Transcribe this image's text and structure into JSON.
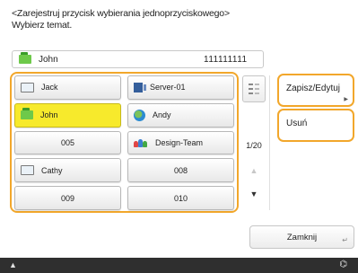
{
  "header": {
    "line1": "<Zarejestruj przycisk wybierania jednoprzyciskowego>",
    "line2": "Wybierz temat."
  },
  "selected_entry": {
    "name": "John",
    "number": "111111111",
    "icon": "address-book-green-icon"
  },
  "grid": [
    {
      "label": "Jack",
      "icon": "address-card-icon"
    },
    {
      "label": "Server-01",
      "icon": "server-icon"
    },
    {
      "label": "John",
      "icon": "address-book-green-icon",
      "selected": true
    },
    {
      "label": "Andy",
      "icon": "globe-icon"
    },
    {
      "label": "005",
      "icon": ""
    },
    {
      "label": "Design-Team",
      "icon": "group-icon"
    },
    {
      "label": "Cathy",
      "icon": "address-card-icon"
    },
    {
      "label": "008",
      "icon": ""
    },
    {
      "label": "009",
      "icon": ""
    },
    {
      "label": "010",
      "icon": ""
    }
  ],
  "pager": {
    "counter": "1/20",
    "sort_icon": "sort-icon",
    "up_icon": "arrow-up-icon",
    "down_icon": "arrow-down-icon"
  },
  "actions": {
    "save_edit": "Zapisz/Edytuj",
    "delete": "Usuń"
  },
  "close": {
    "label": "Zamknij"
  },
  "status": {
    "left_glyph": "▲",
    "right_glyph": "⌬"
  },
  "colors": {
    "highlight": "#f2a72b",
    "selected": "#f7ea2c"
  }
}
